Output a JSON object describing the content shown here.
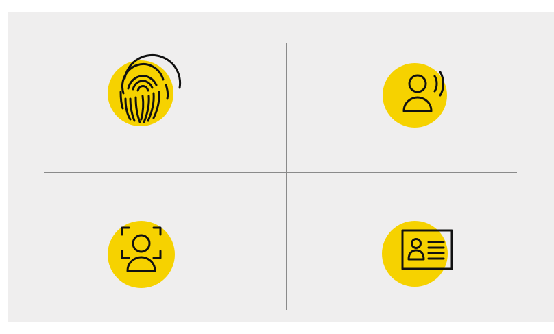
{
  "theme": {
    "accent": "#f6d200",
    "panel_background": "#efeeee",
    "divider": "#8a8a8a",
    "icon_stroke": "#111111"
  },
  "tiles": [
    {
      "icon": "fingerprint-icon"
    },
    {
      "icon": "voice-recognition-icon"
    },
    {
      "icon": "face-scan-icon"
    },
    {
      "icon": "id-card-icon"
    }
  ]
}
